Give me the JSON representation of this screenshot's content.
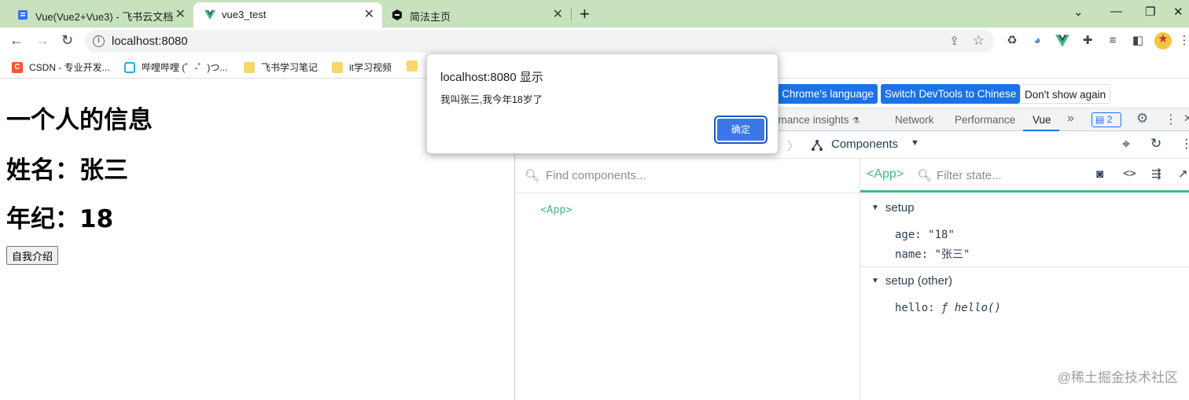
{
  "browser": {
    "tabs": [
      {
        "title": "Vue(Vue2+Vue3) - 飞书云文档",
        "icon": "feishu-doc-icon",
        "active": false
      },
      {
        "title": "vue3_test",
        "icon": "vue-logo-icon",
        "active": true
      },
      {
        "title": "简法主页",
        "icon": "jianfa-icon",
        "active": false
      }
    ],
    "new_tab": "+",
    "url": "localhost:8080",
    "bookmarks": [
      {
        "label": "CSDN - 专业开发...",
        "icon": "csdn-icon"
      },
      {
        "label": "哔哩哔哩 (゜-゜)つ...",
        "icon": "bilibili-icon"
      },
      {
        "label": "飞书学习笔记",
        "icon": "folder-icon"
      },
      {
        "label": "it学习视频",
        "icon": "folder-icon"
      },
      {
        "label": "",
        "icon": "folder-icon"
      }
    ]
  },
  "page": {
    "heading": "一个人的信息",
    "name_line": "姓名：张三",
    "age_line": "年纪：18",
    "intro_button": "自我介绍"
  },
  "dialog": {
    "origin": "localhost:8080 显示",
    "message": "我叫张三,我今年18岁了",
    "ok_button": "确定"
  },
  "devtools": {
    "infobar": {
      "match_language": "n Chrome's language",
      "switch_chinese": "Switch DevTools to Chinese",
      "dont_show": "Don't show again"
    },
    "tabs": [
      {
        "label": "rmance insights"
      },
      {
        "label": "Network"
      },
      {
        "label": "Performance"
      },
      {
        "label": "Vue",
        "active": true
      }
    ],
    "more_tabs": "»",
    "issues_count": "2",
    "vue": {
      "view_label": "Components",
      "find_placeholder": "Find components...",
      "tree_root": "<App>",
      "selected": "<App>",
      "filter_placeholder": "Filter state...",
      "sections": [
        {
          "title": "setup",
          "fields": [
            {
              "key": "age",
              "value": "\"18\""
            },
            {
              "key": "name",
              "value": "\"张三\""
            }
          ]
        },
        {
          "title": "setup (other)",
          "fields": [
            {
              "key": "hello",
              "value": "ƒ hello()"
            }
          ]
        }
      ]
    }
  },
  "watermark": "@稀土掘金技术社区",
  "colors": {
    "vue_green": "#42b883",
    "chrome_blue": "#1a73e8",
    "tabstrip": "#c8e2bd"
  }
}
